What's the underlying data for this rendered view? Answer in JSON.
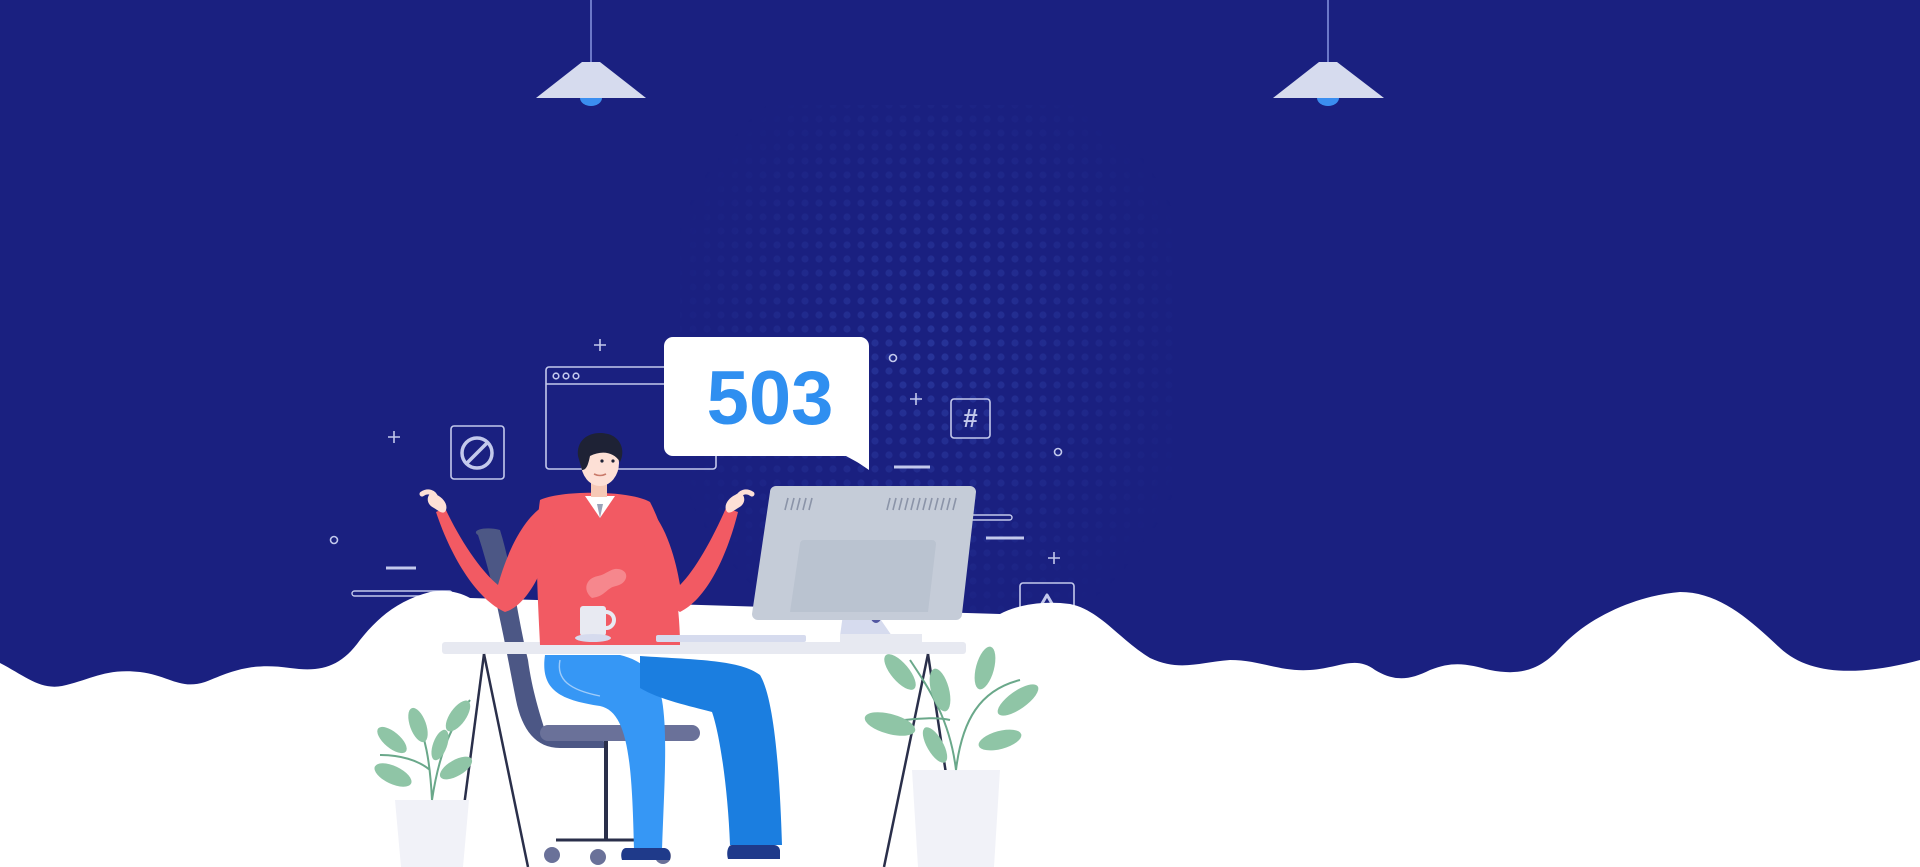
{
  "error": {
    "code": "503"
  },
  "icons": {
    "block": "block-icon",
    "hash": "#",
    "warning": "warning-icon",
    "lamp": "pendant-lamp-icon"
  },
  "colors": {
    "background": "#1a2080",
    "code": "#2f8ff0",
    "sweater": "#f25a63",
    "pants": "#3697f5",
    "pants_shadow": "#1b7ee0",
    "monitor": "#c5ccd8",
    "leaf": "#8fc5a6",
    "white": "#ffffff"
  }
}
